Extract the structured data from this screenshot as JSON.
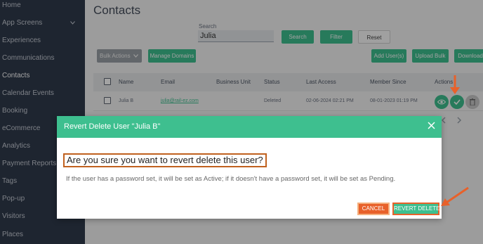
{
  "sidebar": {
    "items": [
      {
        "label": "Home"
      },
      {
        "label": "App Screens",
        "has_chevron": true
      },
      {
        "label": "Experiences"
      },
      {
        "label": "Communications"
      },
      {
        "label": "Contacts",
        "active": true
      },
      {
        "label": "Calendar Events"
      },
      {
        "label": "Booking"
      },
      {
        "label": "eCommerce"
      },
      {
        "label": "Analytics"
      },
      {
        "label": "Payment Reports"
      },
      {
        "label": "Tags"
      },
      {
        "label": "Pop-up"
      },
      {
        "label": "Visitors"
      },
      {
        "label": "Places"
      }
    ],
    "chevron_icon": "chevron-down-icon"
  },
  "page": {
    "title": "Contacts",
    "search_label": "Search",
    "search_value": "Julia",
    "search_button": "Search",
    "filter_button": "Filter",
    "reset_button": "Reset",
    "bulk_actions": "Bulk Actions",
    "manage_domains": "Manage Domains",
    "add_users": "Add User(s)",
    "upload_bulk": "Upload Bulk",
    "download": "Download"
  },
  "table": {
    "columns": [
      "Name",
      "Email",
      "Business Unit",
      "Status",
      "Last Access",
      "Member Since",
      "Actions"
    ],
    "rows": [
      {
        "name": "Julia B",
        "email": "julia@rail-ez.com",
        "business_unit": "",
        "status": "Deleted",
        "last_access": "02-06-2024 02:21 PM",
        "member_since": "08-01-2023 01:19 PM",
        "actions": [
          "eye-icon",
          "check-circle-icon",
          "trash-icon"
        ]
      }
    ]
  },
  "pager": {
    "prev_icon": "chevron-left-icon",
    "next_icon": "chevron-right-icon"
  },
  "modal": {
    "title": "Revert Delete User \"Julia B\"",
    "question": "Are you sure you want to revert delete this user?",
    "description": "If the user has a password set, it will be set as Active; if it doesn't have a password set, it will be set as Pending.",
    "cancel_label": "CANCEL",
    "confirm_label": "REVERT DELETE"
  },
  "colors": {
    "accent": "#3ebf8f",
    "sidebar": "#2f3a4c",
    "highlight": "#e8612a"
  }
}
